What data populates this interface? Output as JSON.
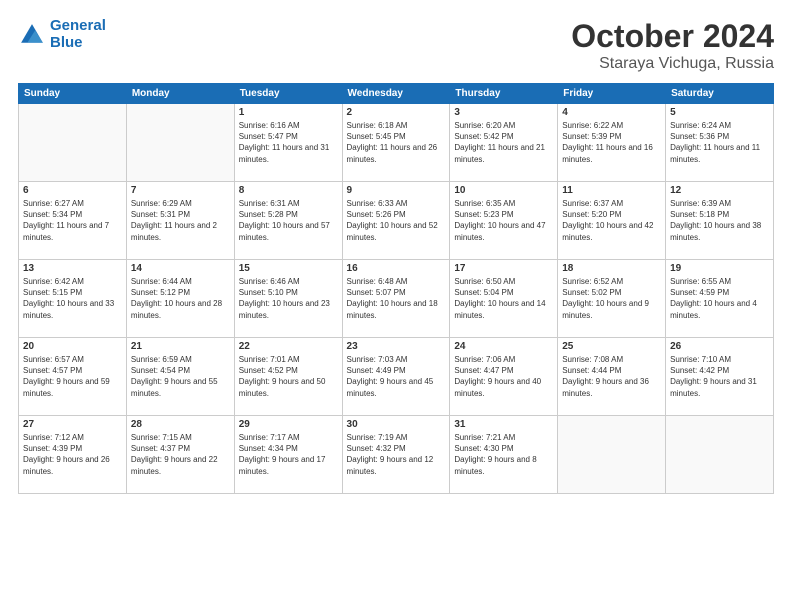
{
  "header": {
    "logo_line1": "General",
    "logo_line2": "Blue",
    "month": "October 2024",
    "location": "Staraya Vichuga, Russia"
  },
  "weekdays": [
    "Sunday",
    "Monday",
    "Tuesday",
    "Wednesday",
    "Thursday",
    "Friday",
    "Saturday"
  ],
  "weeks": [
    [
      {
        "day": "",
        "info": ""
      },
      {
        "day": "",
        "info": ""
      },
      {
        "day": "1",
        "info": "Sunrise: 6:16 AM\nSunset: 5:47 PM\nDaylight: 11 hours and 31 minutes."
      },
      {
        "day": "2",
        "info": "Sunrise: 6:18 AM\nSunset: 5:45 PM\nDaylight: 11 hours and 26 minutes."
      },
      {
        "day": "3",
        "info": "Sunrise: 6:20 AM\nSunset: 5:42 PM\nDaylight: 11 hours and 21 minutes."
      },
      {
        "day": "4",
        "info": "Sunrise: 6:22 AM\nSunset: 5:39 PM\nDaylight: 11 hours and 16 minutes."
      },
      {
        "day": "5",
        "info": "Sunrise: 6:24 AM\nSunset: 5:36 PM\nDaylight: 11 hours and 11 minutes."
      }
    ],
    [
      {
        "day": "6",
        "info": "Sunrise: 6:27 AM\nSunset: 5:34 PM\nDaylight: 11 hours and 7 minutes."
      },
      {
        "day": "7",
        "info": "Sunrise: 6:29 AM\nSunset: 5:31 PM\nDaylight: 11 hours and 2 minutes."
      },
      {
        "day": "8",
        "info": "Sunrise: 6:31 AM\nSunset: 5:28 PM\nDaylight: 10 hours and 57 minutes."
      },
      {
        "day": "9",
        "info": "Sunrise: 6:33 AM\nSunset: 5:26 PM\nDaylight: 10 hours and 52 minutes."
      },
      {
        "day": "10",
        "info": "Sunrise: 6:35 AM\nSunset: 5:23 PM\nDaylight: 10 hours and 47 minutes."
      },
      {
        "day": "11",
        "info": "Sunrise: 6:37 AM\nSunset: 5:20 PM\nDaylight: 10 hours and 42 minutes."
      },
      {
        "day": "12",
        "info": "Sunrise: 6:39 AM\nSunset: 5:18 PM\nDaylight: 10 hours and 38 minutes."
      }
    ],
    [
      {
        "day": "13",
        "info": "Sunrise: 6:42 AM\nSunset: 5:15 PM\nDaylight: 10 hours and 33 minutes."
      },
      {
        "day": "14",
        "info": "Sunrise: 6:44 AM\nSunset: 5:12 PM\nDaylight: 10 hours and 28 minutes."
      },
      {
        "day": "15",
        "info": "Sunrise: 6:46 AM\nSunset: 5:10 PM\nDaylight: 10 hours and 23 minutes."
      },
      {
        "day": "16",
        "info": "Sunrise: 6:48 AM\nSunset: 5:07 PM\nDaylight: 10 hours and 18 minutes."
      },
      {
        "day": "17",
        "info": "Sunrise: 6:50 AM\nSunset: 5:04 PM\nDaylight: 10 hours and 14 minutes."
      },
      {
        "day": "18",
        "info": "Sunrise: 6:52 AM\nSunset: 5:02 PM\nDaylight: 10 hours and 9 minutes."
      },
      {
        "day": "19",
        "info": "Sunrise: 6:55 AM\nSunset: 4:59 PM\nDaylight: 10 hours and 4 minutes."
      }
    ],
    [
      {
        "day": "20",
        "info": "Sunrise: 6:57 AM\nSunset: 4:57 PM\nDaylight: 9 hours and 59 minutes."
      },
      {
        "day": "21",
        "info": "Sunrise: 6:59 AM\nSunset: 4:54 PM\nDaylight: 9 hours and 55 minutes."
      },
      {
        "day": "22",
        "info": "Sunrise: 7:01 AM\nSunset: 4:52 PM\nDaylight: 9 hours and 50 minutes."
      },
      {
        "day": "23",
        "info": "Sunrise: 7:03 AM\nSunset: 4:49 PM\nDaylight: 9 hours and 45 minutes."
      },
      {
        "day": "24",
        "info": "Sunrise: 7:06 AM\nSunset: 4:47 PM\nDaylight: 9 hours and 40 minutes."
      },
      {
        "day": "25",
        "info": "Sunrise: 7:08 AM\nSunset: 4:44 PM\nDaylight: 9 hours and 36 minutes."
      },
      {
        "day": "26",
        "info": "Sunrise: 7:10 AM\nSunset: 4:42 PM\nDaylight: 9 hours and 31 minutes."
      }
    ],
    [
      {
        "day": "27",
        "info": "Sunrise: 7:12 AM\nSunset: 4:39 PM\nDaylight: 9 hours and 26 minutes."
      },
      {
        "day": "28",
        "info": "Sunrise: 7:15 AM\nSunset: 4:37 PM\nDaylight: 9 hours and 22 minutes."
      },
      {
        "day": "29",
        "info": "Sunrise: 7:17 AM\nSunset: 4:34 PM\nDaylight: 9 hours and 17 minutes."
      },
      {
        "day": "30",
        "info": "Sunrise: 7:19 AM\nSunset: 4:32 PM\nDaylight: 9 hours and 12 minutes."
      },
      {
        "day": "31",
        "info": "Sunrise: 7:21 AM\nSunset: 4:30 PM\nDaylight: 9 hours and 8 minutes."
      },
      {
        "day": "",
        "info": ""
      },
      {
        "day": "",
        "info": ""
      }
    ]
  ]
}
